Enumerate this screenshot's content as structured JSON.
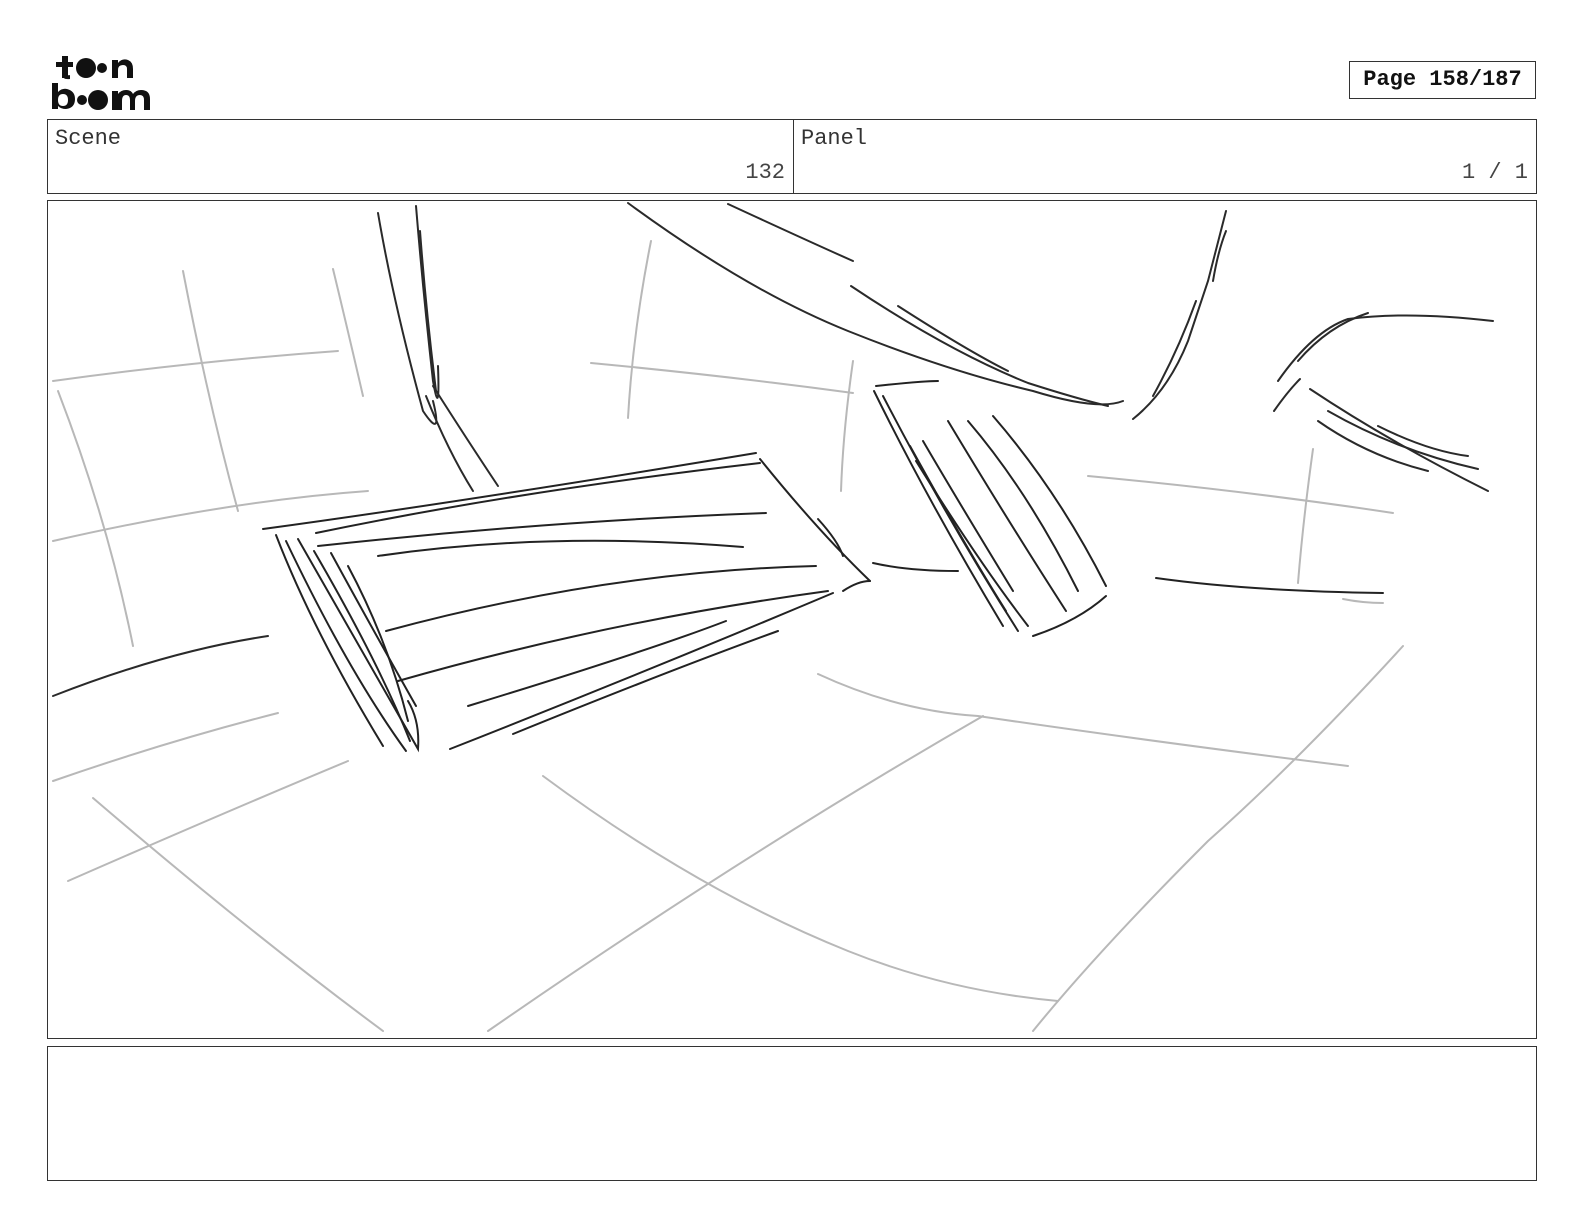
{
  "logo": {
    "text": "toon boom"
  },
  "page": {
    "label": "Page 158/187"
  },
  "header": {
    "scene_label": "Scene",
    "scene_value": "132",
    "panel_label": "Panel",
    "panel_value": "1 / 1"
  },
  "notes": {
    "text": ""
  },
  "colors": {
    "ink": "#222222",
    "pencil": "#b8b8b8",
    "border": "#333333"
  }
}
